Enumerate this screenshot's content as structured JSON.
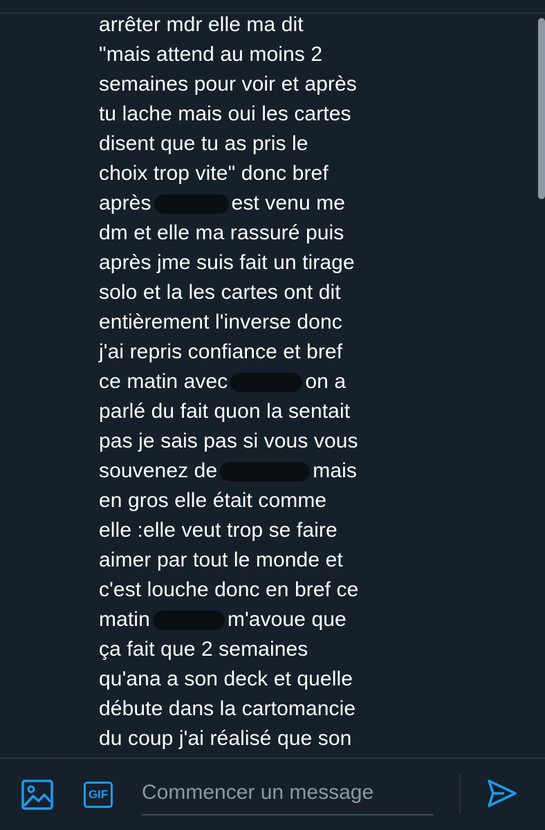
{
  "message": {
    "lines": [
      "arrêter mdr elle ma dit",
      "\"mais attend au moins 2",
      "semaines pour voir et après",
      "tu lache mais oui les cartes",
      "disent que tu as pris le",
      "choix trop vite\" donc bref",
      [
        "après",
        "est venu me"
      ],
      "dm et elle ma rassuré puis",
      "après jme suis fait un tirage",
      "solo et la les cartes ont dit",
      "entièrement l'inverse donc",
      "j'ai repris confiance et bref",
      [
        "ce matin avec",
        "on a"
      ],
      "parlé du fait quon la sentait",
      "pas je sais pas si vous vous",
      [
        "souvenez de",
        "mais"
      ],
      "en gros elle était comme",
      "elle :elle veut trop se faire",
      "aimer par tout le monde et",
      "c'est louche donc en bref ce",
      [
        "matin",
        "m'avoue que"
      ],
      "ça fait que 2 semaines",
      "qu'ana a son deck et quelle",
      "débute dans la cartomancie",
      "du coup j'ai réalisé que son"
    ]
  },
  "composer": {
    "placeholder": "Commencer un message",
    "gif_label": "GIF",
    "image_icon": "image-icon",
    "send_icon": "send-icon"
  },
  "colors": {
    "background": "#15202b",
    "accent": "#1d9bf0",
    "text": "#ffffff",
    "placeholder": "#8b98a5"
  }
}
